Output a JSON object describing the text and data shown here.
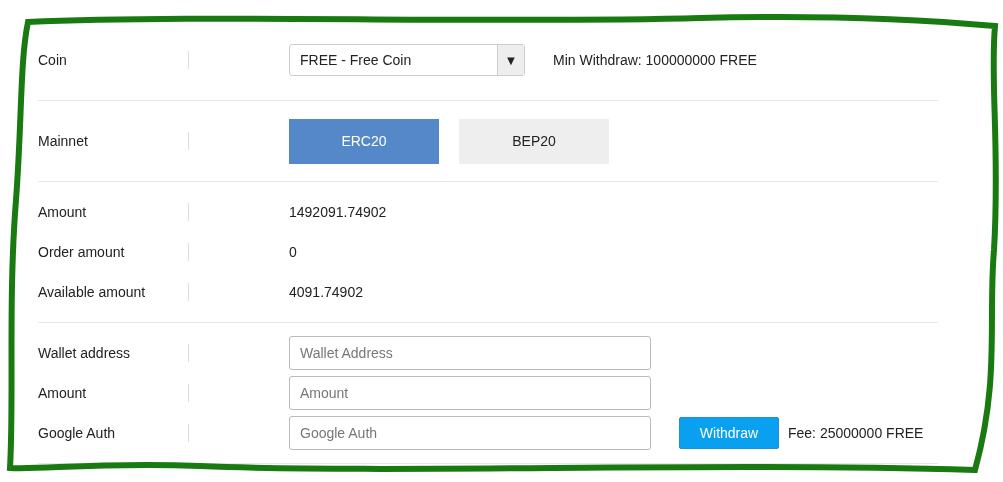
{
  "coin": {
    "label": "Coin",
    "value": "FREE - Free Coin",
    "caret": "▼",
    "min_withdraw": "Min Withdraw: 100000000 FREE"
  },
  "mainnet": {
    "label": "Mainnet",
    "options": [
      {
        "label": "ERC20",
        "selected": true
      },
      {
        "label": "BEP20",
        "selected": false
      }
    ]
  },
  "balances": [
    {
      "label": "Amount",
      "value": "1492091.74902"
    },
    {
      "label": "Order amount",
      "value": "0"
    },
    {
      "label": "Available amount",
      "value": "4091.74902"
    }
  ],
  "fields": [
    {
      "label": "Wallet address",
      "placeholder": "Wallet Address"
    },
    {
      "label": "Amount",
      "placeholder": "Amount"
    },
    {
      "label": "Google Auth",
      "placeholder": "Google Auth"
    }
  ],
  "withdraw_button": "Withdraw",
  "fee": "Fee: 25000000 FREE"
}
